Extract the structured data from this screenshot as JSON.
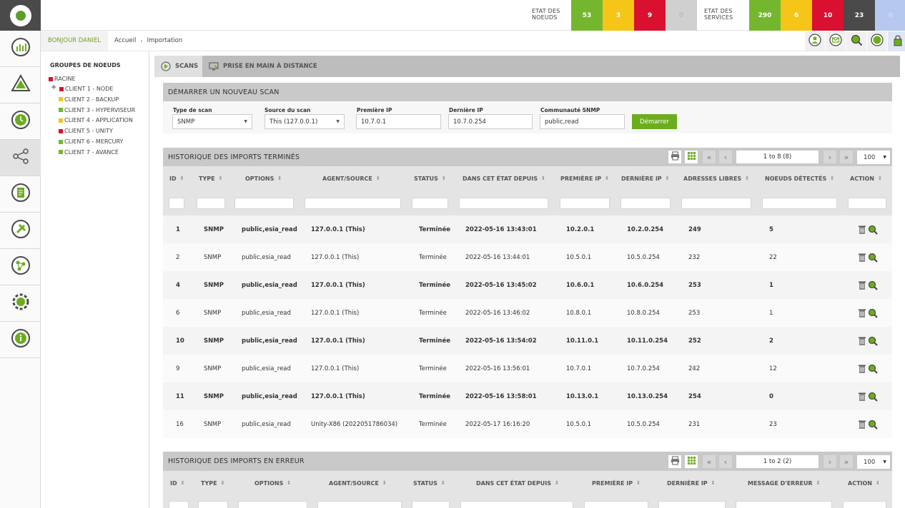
{
  "colors": {
    "green": "#74b72e",
    "yellow": "#f5c518",
    "red": "#d9102f",
    "dark": "#4a4a4a",
    "grey": "#d0d0d0",
    "blue": "#b7c8ef",
    "accent": "#6cad1e"
  },
  "top": {
    "nodes_label_1": "ETAT DES",
    "nodes_label_2": "NOEUDS",
    "nodes_values": [
      "53",
      "3",
      "9",
      "0"
    ],
    "services_label_1": "ETAT DES",
    "services_label_2": "SERVICES",
    "services_values": [
      "290",
      "6",
      "10",
      "23",
      "0"
    ]
  },
  "sub": {
    "greeting": "BONJOUR DANIEL",
    "crumb_home": "Accueil",
    "crumb_current": "Importation",
    "icons": [
      "user-icon",
      "mail-icon",
      "search-icon",
      "status-icon",
      "lock-icon"
    ]
  },
  "nav_icons": [
    "dashboard-icon",
    "alert-icon",
    "clock-icon",
    "network-icon",
    "report-icon",
    "tools-icon",
    "topology-icon",
    "settings-icon",
    "info-icon"
  ],
  "tree": {
    "title": "GROUPES DE NOEUDS",
    "root": "RACINE",
    "items": [
      {
        "label": "CLIENT 1 - NODE",
        "color": "#d9102f"
      },
      {
        "label": "CLIENT 2 - BACKUP",
        "color": "#f5c518"
      },
      {
        "label": "CLIENT 3 - HYPERVISEUR",
        "color": "#74b72e"
      },
      {
        "label": "CLIENT 4 - APPLICATION",
        "color": "#f5c518"
      },
      {
        "label": "CLIENT 5 - UNITY",
        "color": "#d9102f"
      },
      {
        "label": "CLIENT 6 - MERCURY",
        "color": "#74b72e"
      },
      {
        "label": "CLIENT 7 - AVANCÉ",
        "color": "#74b72e"
      }
    ]
  },
  "tabs": {
    "scans": "SCANS",
    "remote": "PRISE EN MAIN À DISTANCE"
  },
  "newscan": {
    "title": "DÉMARRER UN NOUVEAU SCAN",
    "type_label": "Type de scan",
    "type_value": "SNMP",
    "source_label": "Source du scan",
    "source_value": "This (127.0.0.1)",
    "first_ip_label": "Première IP",
    "first_ip_value": "10.7.0.1",
    "last_ip_label": "Dernière IP",
    "last_ip_value": "10.7.0.254",
    "community_label": "Communauté SNMP",
    "community_value": "public,read",
    "start_label": "Démarrer"
  },
  "done": {
    "title": "HISTORIQUE DES IMPORTS TERMINÉS",
    "pager": "1 to 8 (8)",
    "page_size": "100",
    "headers": [
      "ID",
      "TYPE",
      "OPTIONS",
      "AGENT/SOURCE",
      "STATUS",
      "DANS CET ÉTAT DEPUIS",
      "PREMIÈRE IP",
      "DERNIÈRE IP",
      "ADRESSES LIBRES",
      "NOEUDS DÉTECTÉS",
      "ACTION"
    ],
    "rows": [
      [
        "1",
        "SNMP",
        "public,esia_read",
        "127.0.0.1 (This)",
        "Terminée",
        "2022-05-16 13:43:01",
        "10.2.0.1",
        "10.2.0.254",
        "249",
        "5"
      ],
      [
        "2",
        "SNMP",
        "public,esia_read",
        "127.0.0.1 (This)",
        "Terminée",
        "2022-05-16 13:44:01",
        "10.5.0.1",
        "10.5.0.254",
        "232",
        "22"
      ],
      [
        "4",
        "SNMP",
        "public,esia_read",
        "127.0.0.1 (This)",
        "Terminée",
        "2022-05-16 13:45:02",
        "10.6.0.1",
        "10.6.0.254",
        "253",
        "1"
      ],
      [
        "6",
        "SNMP",
        "public,esia_read",
        "127.0.0.1 (This)",
        "Terminée",
        "2022-05-16 13:46:02",
        "10.8.0.1",
        "10.8.0.254",
        "253",
        "1"
      ],
      [
        "10",
        "SNMP",
        "public,esia_read",
        "127.0.0.1 (This)",
        "Terminée",
        "2022-05-16 13:54:02",
        "10.11.0.1",
        "10.11.0.254",
        "252",
        "2"
      ],
      [
        "9",
        "SNMP",
        "public,esia_read",
        "127.0.0.1 (This)",
        "Terminée",
        "2022-05-16 13:56:01",
        "10.7.0.1",
        "10.7.0.254",
        "242",
        "12"
      ],
      [
        "11",
        "SNMP",
        "public,esia_read",
        "127.0.0.1 (This)",
        "Terminée",
        "2022-05-16 13:58:01",
        "10.13.0.1",
        "10.13.0.254",
        "254",
        "0"
      ],
      [
        "16",
        "SNMP",
        "public,esia_read",
        "Unity-X86 (2022051786034)",
        "Terminée",
        "2022-05-17 16:16:20",
        "10.5.0.1",
        "10.5.0.254",
        "231",
        "23"
      ]
    ]
  },
  "errors": {
    "title": "HISTORIQUE DES IMPORTS EN ERREUR",
    "pager": "1 to 2 (2)",
    "page_size": "100",
    "headers": [
      "ID",
      "TYPE",
      "OPTIONS",
      "AGENT/SOURCE",
      "STATUS",
      "DANS CET ÉTAT DEPUIS",
      "PREMIÈRE IP",
      "DERNIÈRE IP",
      "MESSAGE D'ERREUR",
      "ACTION"
    ]
  }
}
